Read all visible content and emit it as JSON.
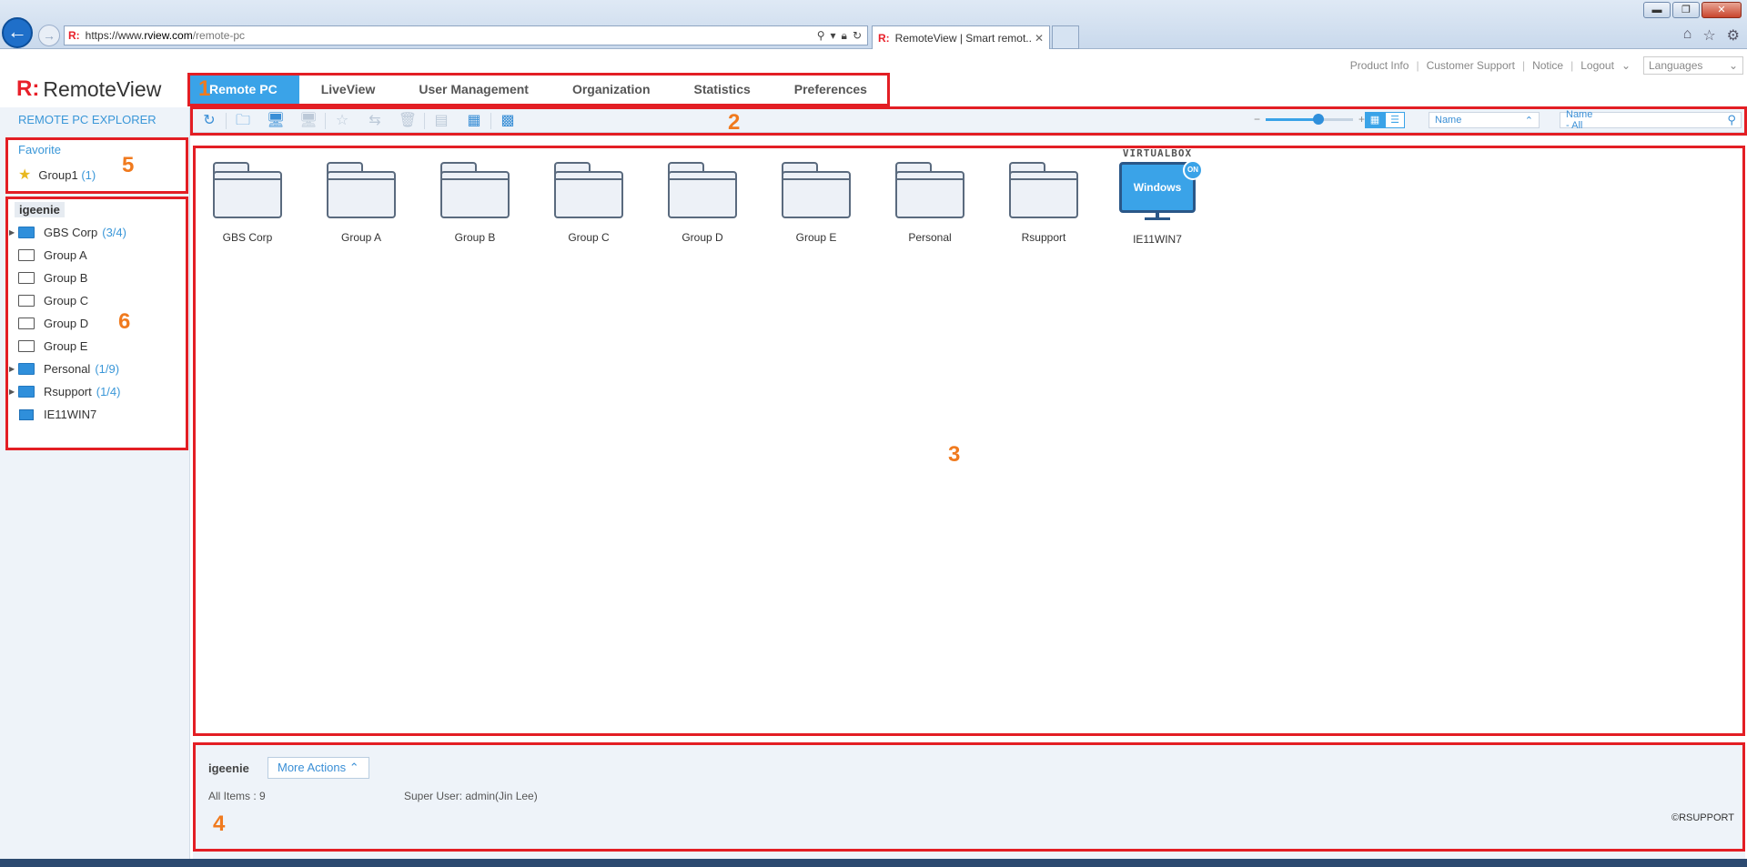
{
  "browser": {
    "url_prefix": "https://www.",
    "url_domain": "rview.com",
    "url_path": "/remote-pc",
    "tab_title": "RemoteView | Smart remot..."
  },
  "header": {
    "logo_text": "RemoteView",
    "links": [
      "Product Info",
      "Customer Support",
      "Notice",
      "Logout"
    ],
    "language_placeholder": "Languages"
  },
  "main_tabs": [
    "Remote PC",
    "LiveView",
    "User Management",
    "Organization",
    "Statistics",
    "Preferences"
  ],
  "left_panel": {
    "title": "REMOTE PC EXPLORER",
    "favorite": {
      "title": "Favorite",
      "items": [
        {
          "label": "Group1",
          "count": "(1)"
        }
      ]
    },
    "tree": {
      "owner": "igeenie",
      "items": [
        {
          "label": "GBS Corp",
          "count": "(3/4)",
          "type": "folder-filled",
          "expandable": true
        },
        {
          "label": "Group A",
          "count": "",
          "type": "folder-empty",
          "expandable": false
        },
        {
          "label": "Group B",
          "count": "",
          "type": "folder-empty",
          "expandable": false
        },
        {
          "label": "Group C",
          "count": "",
          "type": "folder-empty",
          "expandable": false
        },
        {
          "label": "Group D",
          "count": "",
          "type": "folder-empty",
          "expandable": false
        },
        {
          "label": "Group E",
          "count": "",
          "type": "folder-empty",
          "expandable": false
        },
        {
          "label": "Personal",
          "count": "(1/9)",
          "type": "folder-filled",
          "expandable": true
        },
        {
          "label": "Rsupport",
          "count": "(1/4)",
          "type": "folder-filled",
          "expandable": true
        },
        {
          "label": "IE11WIN7",
          "count": "",
          "type": "monitor",
          "expandable": false
        }
      ]
    }
  },
  "toolbar": {
    "zoom_level": 0.6,
    "sort_value": "Name",
    "search_scope": "Name - All",
    "search_value": ""
  },
  "content": {
    "folders": [
      "GBS Corp",
      "Group A",
      "Group B",
      "Group C",
      "Group D",
      "Group E",
      "Personal",
      "Rsupport"
    ],
    "pc": {
      "top_label": "VIRTUALBOX",
      "screen_label": "Windows",
      "badge": "ON",
      "name": "IE11WIN7"
    }
  },
  "footer": {
    "owner": "igeenie",
    "more_actions": "More Actions",
    "all_items": "All Items : 9",
    "super_user": "Super User: admin(Jin Lee)",
    "copyright": "©RSUPPORT"
  },
  "annotations": [
    "1",
    "2",
    "3",
    "4",
    "5",
    "6"
  ],
  "colors": {
    "accent": "#3aa3e8",
    "annotation": "#e31e24",
    "annotation_text": "#f07a1e",
    "brand": "#e8202a"
  }
}
